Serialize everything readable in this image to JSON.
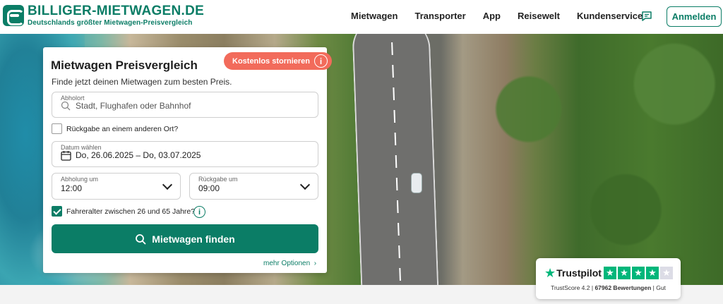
{
  "brand": {
    "name": "BILLIGER-MIETWAGEN.DE",
    "tagline": "Deutschlands größter Mietwagen-Preisvergleich"
  },
  "nav": {
    "items": [
      "Mietwagen",
      "Transporter",
      "App",
      "Reisewelt",
      "Kundenservice"
    ],
    "login_label": "Anmelden"
  },
  "search": {
    "title": "Mietwagen Preisvergleich",
    "subtitle": "Finde jetzt deinen Mietwagen zum besten Preis.",
    "cancel_badge": "Kostenlos stornieren",
    "pickup_label": "Abholort",
    "pickup_placeholder": "Stadt, Flughafen oder Bahnhof",
    "return_other_label": "Rückgabe an einem anderen Ort?",
    "return_other_checked": false,
    "date_label": "Datum wählen",
    "date_value": "Do, 26.06.2025 – Do, 03.07.2025",
    "pickup_time_label": "Abholung um",
    "pickup_time_value": "12:00",
    "return_time_label": "Rückgabe um",
    "return_time_value": "09:00",
    "driver_age_label": "Fahreralter zwischen 26 und 65 Jahre?",
    "driver_age_checked": true,
    "submit_label": "Mietwagen finden",
    "more_options_label": "mehr Optionen"
  },
  "trustpilot": {
    "brand": "Trustpilot",
    "rating_stars": 4.2,
    "trustscore_label": "TrustScore 4.2",
    "reviews_label": "67962 Bewertungen",
    "verdict": "Gut"
  },
  "colors": {
    "brand_green": "#0b7d66",
    "badge_coral": "#f26b5b",
    "trustpilot_green": "#00b67a"
  }
}
